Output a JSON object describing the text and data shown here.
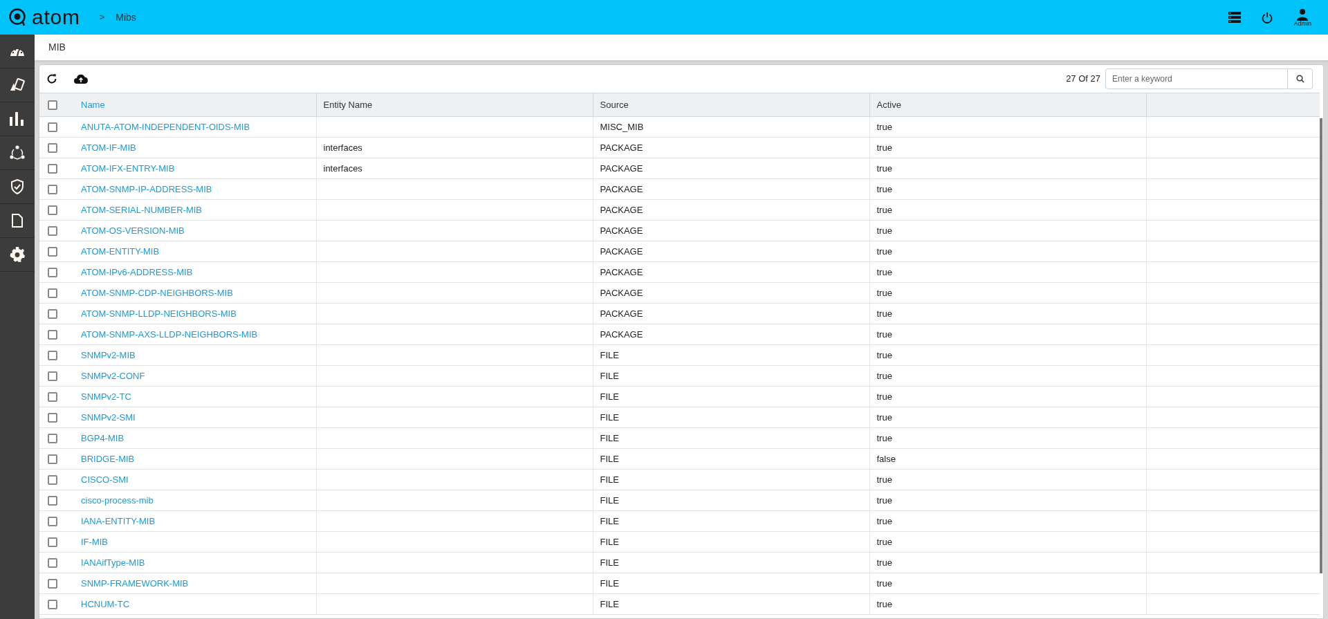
{
  "topbar": {
    "logo": "atom",
    "breadcrumb_separator": ">",
    "breadcrumb": "Mibs",
    "user_label": "Admin"
  },
  "sidebar": {
    "items": [
      {
        "kind": "dashboard",
        "selected": false
      },
      {
        "kind": "cards",
        "selected": false
      },
      {
        "kind": "chart",
        "selected": false
      },
      {
        "kind": "network",
        "selected": false
      },
      {
        "kind": "shield",
        "selected": false
      },
      {
        "kind": "document",
        "selected": false
      },
      {
        "kind": "settings",
        "selected": false
      }
    ]
  },
  "page_title": "MIB",
  "toolbar": {
    "count": "27 Of 27",
    "search": {
      "placeholder": "Enter a keyword"
    }
  },
  "table": {
    "all_checked": false,
    "columns": [
      "Name",
      "Entity Name",
      "Source",
      "Active"
    ],
    "rows": [
      {
        "name": "ANUTA-ATOM-INDEPENDENT-OIDS-MIB",
        "entity": "",
        "source": "MISC_MIB",
        "active": "true",
        "checked": false
      },
      {
        "name": "ATOM-IF-MIB",
        "entity": "interfaces",
        "source": "PACKAGE",
        "active": "true",
        "checked": false
      },
      {
        "name": "ATOM-IFX-ENTRY-MIB",
        "entity": "interfaces",
        "source": "PACKAGE",
        "active": "true",
        "checked": false
      },
      {
        "name": "ATOM-SNMP-IP-ADDRESS-MIB",
        "entity": "",
        "source": "PACKAGE",
        "active": "true",
        "checked": false
      },
      {
        "name": "ATOM-SERIAL-NUMBER-MIB",
        "entity": "",
        "source": "PACKAGE",
        "active": "true",
        "checked": false
      },
      {
        "name": "ATOM-OS-VERSION-MIB",
        "entity": "",
        "source": "PACKAGE",
        "active": "true",
        "checked": false
      },
      {
        "name": "ATOM-ENTITY-MIB",
        "entity": "",
        "source": "PACKAGE",
        "active": "true",
        "checked": false
      },
      {
        "name": "ATOM-IPv6-ADDRESS-MIB",
        "entity": "",
        "source": "PACKAGE",
        "active": "true",
        "checked": false
      },
      {
        "name": "ATOM-SNMP-CDP-NEIGHBORS-MIB",
        "entity": "",
        "source": "PACKAGE",
        "active": "true",
        "checked": false
      },
      {
        "name": "ATOM-SNMP-LLDP-NEIGHBORS-MIB",
        "entity": "",
        "source": "PACKAGE",
        "active": "true",
        "checked": false
      },
      {
        "name": "ATOM-SNMP-AXS-LLDP-NEIGHBORS-MIB",
        "entity": "",
        "source": "PACKAGE",
        "active": "true",
        "checked": false
      },
      {
        "name": "SNMPv2-MIB",
        "entity": "",
        "source": "FILE",
        "active": "true",
        "checked": false
      },
      {
        "name": "SNMPv2-CONF",
        "entity": "",
        "source": "FILE",
        "active": "true",
        "checked": false
      },
      {
        "name": "SNMPv2-TC",
        "entity": "",
        "source": "FILE",
        "active": "true",
        "checked": false
      },
      {
        "name": "SNMPv2-SMI",
        "entity": "",
        "source": "FILE",
        "active": "true",
        "checked": false
      },
      {
        "name": "BGP4-MIB",
        "entity": "",
        "source": "FILE",
        "active": "true",
        "checked": false
      },
      {
        "name": "BRIDGE-MIB",
        "entity": "",
        "source": "FILE",
        "active": "false",
        "checked": false
      },
      {
        "name": "CISCO-SMI",
        "entity": "",
        "source": "FILE",
        "active": "true",
        "checked": false
      },
      {
        "name": "cisco-process-mib",
        "entity": "",
        "source": "FILE",
        "active": "true",
        "checked": false
      },
      {
        "name": "IANA-ENTITY-MIB",
        "entity": "",
        "source": "FILE",
        "active": "true",
        "checked": false
      },
      {
        "name": "IF-MIB",
        "entity": "",
        "source": "FILE",
        "active": "true",
        "checked": false
      },
      {
        "name": "IANAifType-MIB",
        "entity": "",
        "source": "FILE",
        "active": "true",
        "checked": false
      },
      {
        "name": "SNMP-FRAMEWORK-MIB",
        "entity": "",
        "source": "FILE",
        "active": "true",
        "checked": false
      },
      {
        "name": "HCNUM-TC",
        "entity": "",
        "source": "FILE",
        "active": "true",
        "checked": false
      }
    ]
  }
}
